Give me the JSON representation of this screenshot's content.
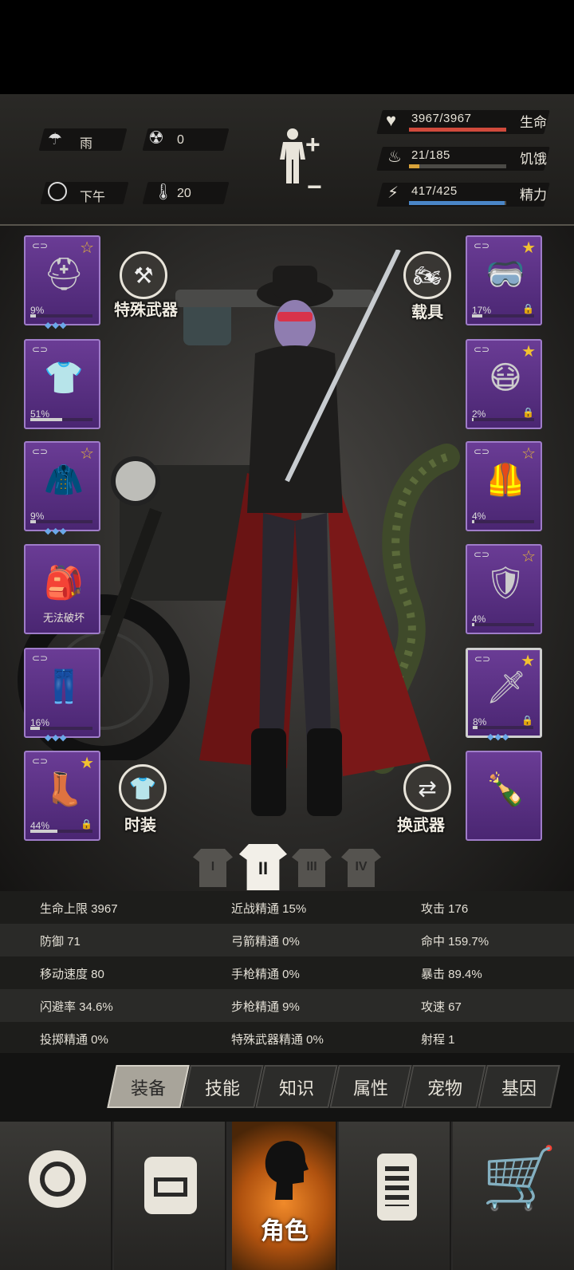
{
  "header": {
    "weather": "雨",
    "radiation": "0",
    "time_of_day": "下午",
    "temperature": "20",
    "hp": {
      "label": "生命",
      "value": "3967/3967",
      "fraction": 1.0,
      "color": "#d04a3c"
    },
    "hunger": {
      "label": "饥饿",
      "value": "21/185",
      "fraction": 0.11,
      "color": "#d9a33a"
    },
    "energy": {
      "label": "精力",
      "value": "417/425",
      "fraction": 0.98,
      "color": "#4a86c8"
    }
  },
  "left_slots": [
    {
      "pct": "9%",
      "durability": 0.09,
      "star": "outline",
      "gems": "◆◆◆",
      "icon": "police-helmet"
    },
    {
      "pct": "51%",
      "durability": 0.51,
      "star": "",
      "gems": "",
      "icon": "sweater"
    },
    {
      "pct": "9%",
      "durability": 0.09,
      "star": "outline",
      "gems": "◆◆◆",
      "icon": "jacket"
    },
    {
      "text": "无法破坏",
      "icon": "backpack"
    },
    {
      "pct": "16%",
      "durability": 0.16,
      "star": "",
      "gems": "◆◆◆",
      "icon": "pants"
    },
    {
      "pct": "44%",
      "durability": 0.44,
      "star": "filled",
      "gems": "",
      "lock": true,
      "icon": "boots"
    }
  ],
  "right_slots": [
    {
      "pct": "17%",
      "durability": 0.17,
      "star": "filled",
      "lock": true,
      "icon": "goggles"
    },
    {
      "pct": "2%",
      "durability": 0.02,
      "star": "filled",
      "lock": true,
      "icon": "gas-mask"
    },
    {
      "pct": "4%",
      "durability": 0.04,
      "star": "outline",
      "icon": "vest"
    },
    {
      "pct": "4%",
      "durability": 0.04,
      "star": "outline",
      "icon": "riot-shield"
    },
    {
      "pct": "8%",
      "durability": 0.08,
      "star": "filled",
      "lock": true,
      "gems": "◆◆◆",
      "icon": "katana"
    },
    {
      "icon": "molotov"
    }
  ],
  "buttons": {
    "special_weapon": "特殊武器",
    "vehicle": "载具",
    "fashion": "时装",
    "swap_weapon": "换武器"
  },
  "outfit_presets": [
    "I",
    "II",
    "III",
    "IV"
  ],
  "stats": [
    [
      "生命上限 3967",
      "近战精通 15%",
      "攻击 176"
    ],
    [
      "防御 71",
      "弓箭精通 0%",
      "命中 159.7%"
    ],
    [
      "移动速度 80",
      "手枪精通 0%",
      "暴击 89.4%"
    ],
    [
      "闪避率 34.6%",
      "步枪精通 9%",
      "攻速 67"
    ],
    [
      "投掷精通 0%",
      "特殊武器精通 0%",
      "射程 1"
    ]
  ],
  "tabs": [
    "装备",
    "技能",
    "知识",
    "属性",
    "宠物",
    "基因"
  ],
  "nav": {
    "active_label": "角色"
  }
}
